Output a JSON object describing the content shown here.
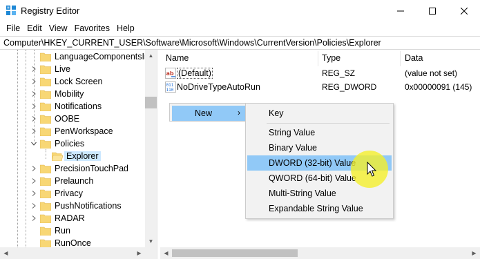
{
  "window": {
    "title": "Registry Editor",
    "controls": {
      "minimize": "—",
      "maximize": "☐",
      "close": "✕"
    }
  },
  "menu": [
    "File",
    "Edit",
    "View",
    "Favorites",
    "Help"
  ],
  "address": "Computer\\HKEY_CURRENT_USER\\Software\\Microsoft\\Windows\\CurrentVersion\\Policies\\Explorer",
  "tree": {
    "items": [
      {
        "label": "LanguageComponentsIn"
      },
      {
        "label": "Live"
      },
      {
        "label": "Lock Screen"
      },
      {
        "label": "Mobility"
      },
      {
        "label": "Notifications"
      },
      {
        "label": "OOBE"
      },
      {
        "label": "PenWorkspace"
      },
      {
        "label": "Policies",
        "expanded": true
      },
      {
        "label": "Explorer",
        "selected": true
      },
      {
        "label": "PrecisionTouchPad"
      },
      {
        "label": "Prelaunch"
      },
      {
        "label": "Privacy"
      },
      {
        "label": "PushNotifications"
      },
      {
        "label": "RADAR"
      },
      {
        "label": "Run"
      },
      {
        "label": "RunOnce"
      }
    ]
  },
  "values": {
    "columns": {
      "name": "Name",
      "type": "Type",
      "data": "Data"
    },
    "rows": [
      {
        "name": "(Default)",
        "type": "REG_SZ",
        "data": "(value not set)",
        "icon": "string-value-icon"
      },
      {
        "name": "NoDriveTypeAutoRun",
        "type": "REG_DWORD",
        "data": "0x00000091 (145)",
        "icon": "binary-value-icon"
      }
    ]
  },
  "context_menu": {
    "new_label": "New",
    "new_arrow": "›",
    "submenu": [
      "Key",
      "String Value",
      "Binary Value",
      "DWORD (32-bit) Value",
      "QWORD (64-bit) Value",
      "Multi-String Value",
      "Expandable String Value"
    ],
    "highlighted": "DWORD (32-bit) Value"
  },
  "colors": {
    "selection": "#cce8ff",
    "menu_highlight": "#91c9f7",
    "folder": "#f8d775",
    "cursor_highlight": "#f5f028"
  }
}
